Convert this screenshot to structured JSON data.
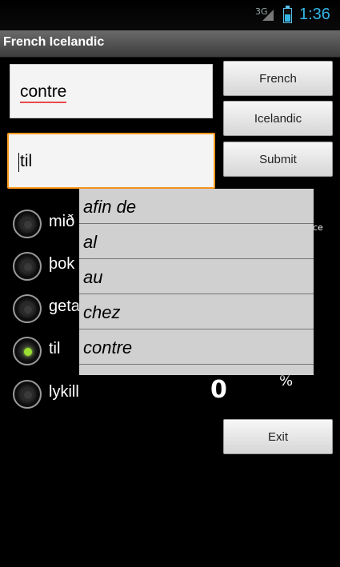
{
  "status": {
    "network": "3G",
    "time": "1:36"
  },
  "app": {
    "title": "French Icelandic"
  },
  "inputs": {
    "source_word": "contre",
    "answer": "til"
  },
  "buttons": {
    "french": "French",
    "icelandic": "Icelandic",
    "submit": "Submit",
    "exit": "Exit"
  },
  "options": [
    {
      "label": "mið",
      "checked": false
    },
    {
      "label": "þok",
      "checked": false
    },
    {
      "label": "geta",
      "checked": false
    },
    {
      "label": "til",
      "checked": true
    },
    {
      "label": "lykill",
      "checked": false
    }
  ],
  "score": {
    "value": "0",
    "percent": "%",
    "ce": "ce"
  },
  "dropdown": {
    "items": [
      "afin de",
      "al",
      "au",
      "chez",
      "contre"
    ]
  },
  "colors": {
    "accent": "#33b5e5",
    "focus": "#ff9a1f",
    "radio_checked": "#9be033"
  }
}
